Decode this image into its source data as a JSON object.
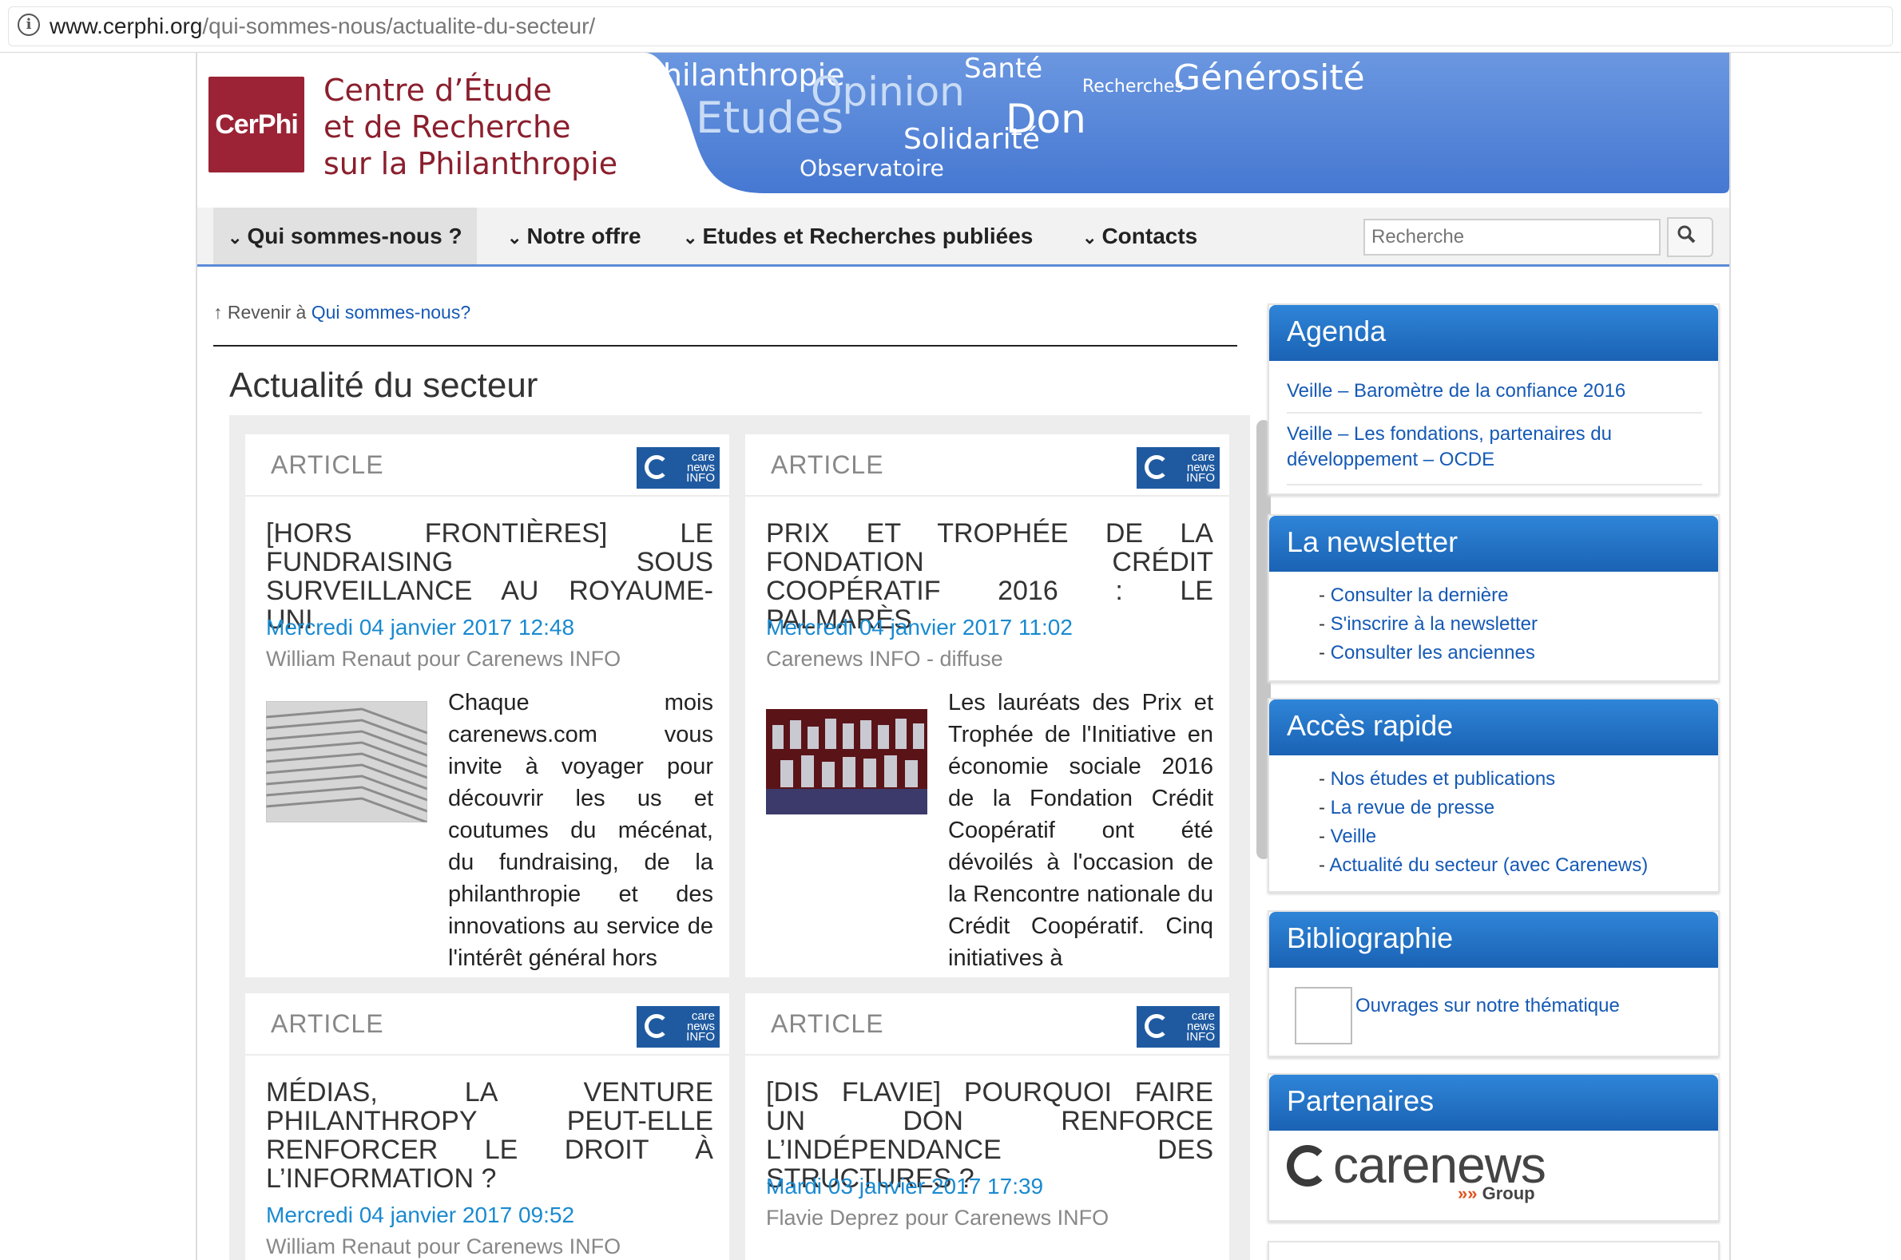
{
  "browser": {
    "url_host": "www.cerphi.org",
    "url_path": "/qui-sommes-nous/actualite-du-secteur/"
  },
  "header": {
    "logo_short": "CerPhi",
    "logo_lines": [
      "Centre d’Étude",
      "et de Recherche",
      "sur la Philanthropie"
    ],
    "banner_words": [
      "Philanthropie",
      "Etudes",
      "Opinion",
      "Observatoire",
      "Santé",
      "Solidarité",
      "Don",
      "Recherches",
      "Générosité"
    ]
  },
  "nav": {
    "items": [
      "Qui sommes-nous ?",
      "Notre offre",
      "Etudes et Recherches publiées",
      "Contacts"
    ],
    "search_placeholder": "Recherche"
  },
  "breadcrumb": {
    "prefix": "Revenir à",
    "link": "Qui sommes-nous?"
  },
  "page_title": "Actualité du secteur",
  "articles": [
    {
      "type": "ARTICLE",
      "badge": [
        "care",
        "news",
        "INFO"
      ],
      "title": "[HORS FRONTIÈRES] LE FUNDRAISING SOUS SURVEILLANCE AU ROYAUME-UNI",
      "date": "Mercredi 04 janvier 2017 12:48",
      "author": "William Renaut pour Carenews INFO",
      "body": "Chaque mois carenews.com vous invite à voyager pour découvrir les us et coutumes du mécénat, du fundraising, de la philanthropie et des innovations au service de l'intérêt général hors"
    },
    {
      "type": "ARTICLE",
      "badge": [
        "care",
        "news",
        "INFO"
      ],
      "title": "PRIX ET TROPHÉE DE LA FONDATION CRÉDIT COOPÉRATIF 2016 : LE PALMARÈS",
      "date": "Mercredi 04 janvier 2017 11:02",
      "author": "Carenews INFO - diffuse",
      "body": "Les lauréats des Prix et Trophée de l'Initiative en économie sociale 2016 de la Fondation Crédit Coopératif ont été dévoilés à l'occasion de la Rencontre nationale du Crédit Coopératif. Cinq initiatives à"
    },
    {
      "type": "ARTICLE",
      "badge": [
        "care",
        "news",
        "INFO"
      ],
      "title": "MÉDIAS, LA VENTURE PHILANTHROPY PEUT-ELLE RENFORCER LE DROIT À L’INFORMATION ?",
      "date": "Mercredi 04 janvier 2017 09:52",
      "author": "William Renaut pour Carenews INFO"
    },
    {
      "type": "ARTICLE",
      "badge": [
        "care",
        "news",
        "INFO"
      ],
      "title": "[DIS FLAVIE] POURQUOI FAIRE UN DON RENFORCE L’INDÉPENDANCE DES STRUCTURES ?",
      "date": "Mardi 03 janvier 2017 17:39",
      "author": "Flavie Deprez pour Carenews INFO"
    }
  ],
  "sidebar": {
    "agenda": {
      "title": "Agenda",
      "items": [
        "Veille – Baromètre de la confiance 2016",
        "Veille – Les fondations, partenaires du développement – OCDE"
      ]
    },
    "newsletter": {
      "title": "La newsletter",
      "items": [
        "Consulter la dernière",
        "S'inscrire à la newsletter",
        "Consulter les anciennes"
      ]
    },
    "acces": {
      "title": "Accès rapide",
      "items": [
        "Nos études et publications",
        "La revue de presse",
        "Veille",
        "Actualité du secteur (avec Carenews)"
      ]
    },
    "biblio": {
      "title": "Bibliographie",
      "link": "Ouvrages sur notre thématique"
    },
    "partenaires": {
      "title": "Partenaires",
      "logo_main": "carenews",
      "logo_sub": "Group"
    }
  },
  "colors": {
    "brand_red": "#9b2335",
    "banner_blue": "#4a7fd6",
    "widget_blue": "#1c6fc4",
    "link_blue": "#1559b5",
    "date_blue": "#1a8ad0"
  }
}
